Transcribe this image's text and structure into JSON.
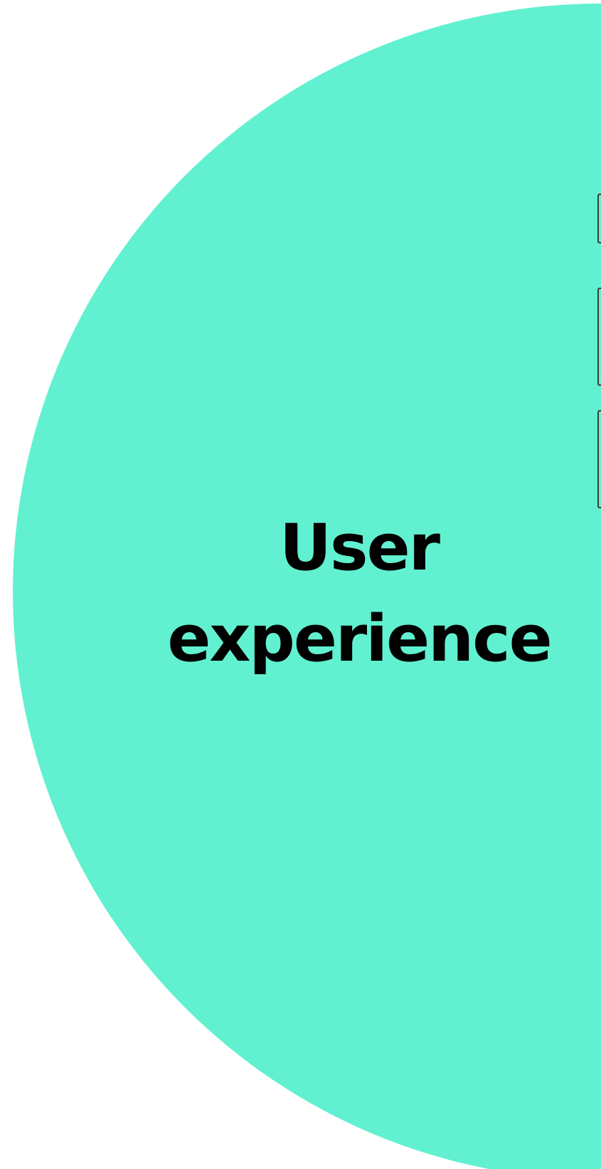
{
  "colors": {
    "background": "#ffffff",
    "circle": "#61f1d0",
    "text": "#000000"
  },
  "heading": {
    "line1": "User",
    "line2": "experience"
  }
}
